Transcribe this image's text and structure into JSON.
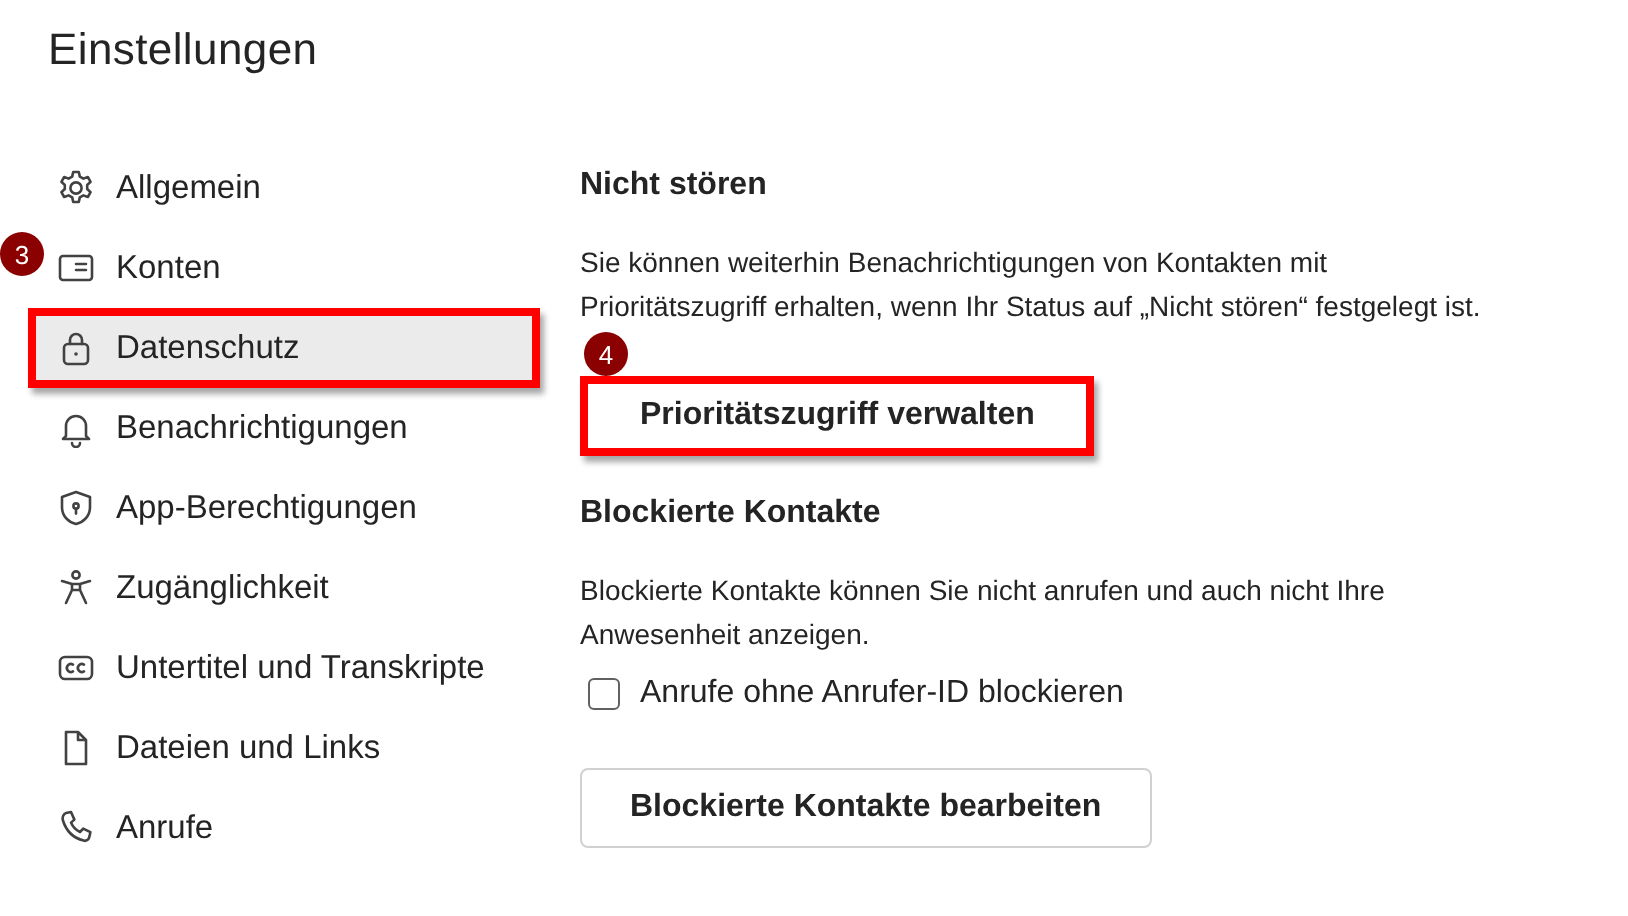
{
  "title": "Einstellungen",
  "sidebar": {
    "items": [
      {
        "label": "Allgemein",
        "selected": false,
        "highlighted": false
      },
      {
        "label": "Konten",
        "selected": false,
        "highlighted": false,
        "marker": "3"
      },
      {
        "label": "Datenschutz",
        "selected": true,
        "highlighted": true
      },
      {
        "label": "Benachrichtigungen",
        "selected": false,
        "highlighted": false
      },
      {
        "label": "App-Berechtigungen",
        "selected": false,
        "highlighted": false
      },
      {
        "label": "Zugänglichkeit",
        "selected": false,
        "highlighted": false
      },
      {
        "label": "Untertitel und Transkripte",
        "selected": false,
        "highlighted": false
      },
      {
        "label": "Dateien und Links",
        "selected": false,
        "highlighted": false
      },
      {
        "label": "Anrufe",
        "selected": false,
        "highlighted": false
      }
    ]
  },
  "sections": [
    {
      "heading": "Nicht stören",
      "text": "Sie können weiterhin Benachrichtigungen von Kontakten mit Prioritätszugriff erhalten, wenn Ihr Status auf „Nicht stören“ festgelegt ist.",
      "controls": [
        {
          "kind": "button",
          "label": "Prioritätszugriff verwalten",
          "highlighted": true,
          "marker": "4"
        }
      ]
    },
    {
      "heading": "Blockierte Kontakte",
      "text": "Blockierte Kontakte können Sie nicht anrufen und auch nicht Ihre Anwesenheit anzeigen.",
      "controls": [
        {
          "kind": "checkbox",
          "label": "Anrufe ohne Anrufer-ID blockieren",
          "checked": false
        },
        {
          "kind": "button",
          "label": "Blockierte Kontakte bearbeiten",
          "highlighted": false
        }
      ]
    }
  ]
}
